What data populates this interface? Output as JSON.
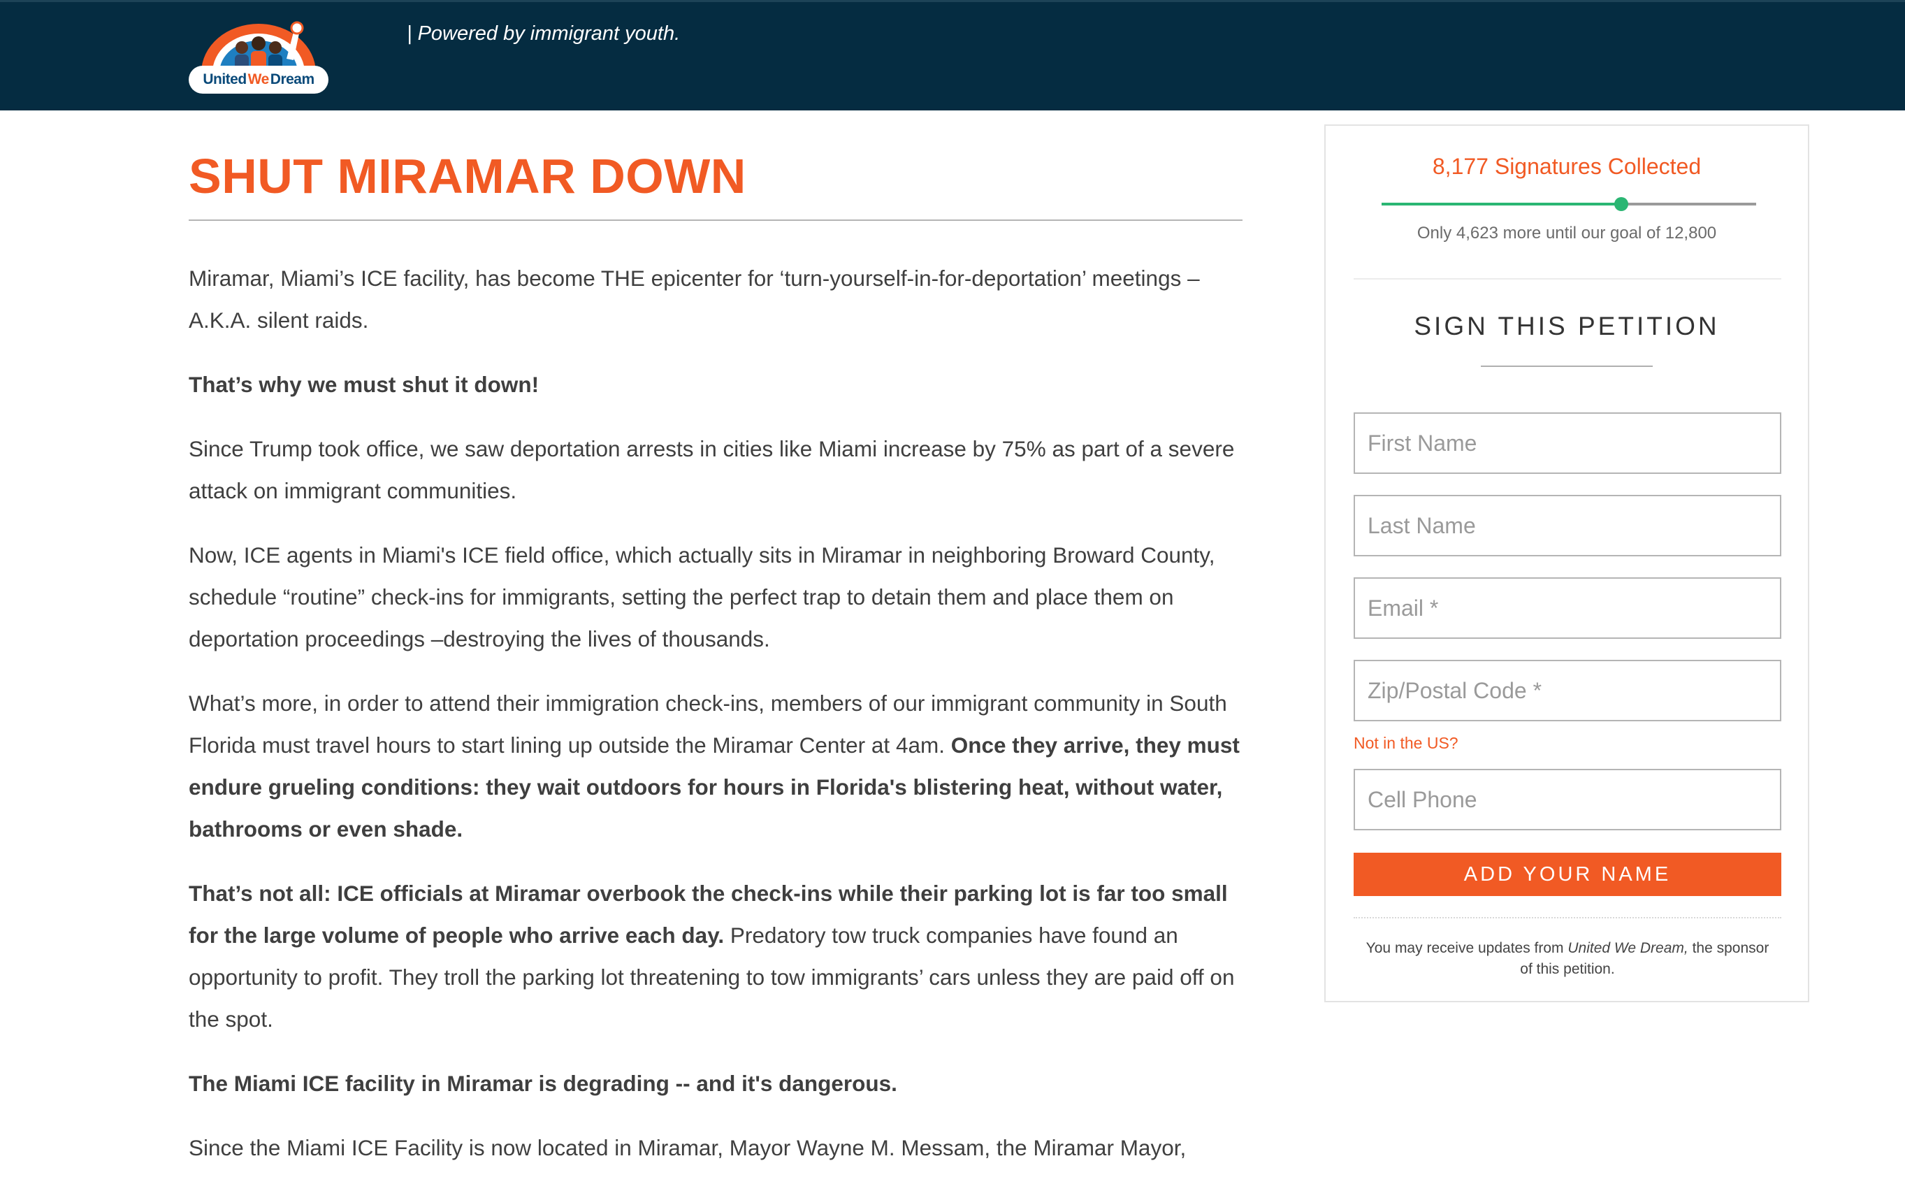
{
  "header": {
    "logo": {
      "word1": "United",
      "word2": "We",
      "word3": "Dream"
    },
    "tagline": "| Powered by immigrant youth.",
    "background": "#052c41"
  },
  "article": {
    "title": "SHUT MIRAMAR DOWN",
    "p1": "Miramar, Miami’s ICE facility, has become THE epicenter for ‘turn-yourself-in-for-deportation’ meetings – A.K.A. silent raids.",
    "p2": "That’s why we must shut it down!",
    "p3": "Since Trump took office, we saw deportation arrests in cities like Miami increase by 75% as part of a severe attack on immigrant communities.",
    "p4": "Now, ICE agents in Miami's ICE field office, which actually sits in Miramar in neighboring Broward County, schedule “routine” check-ins for immigrants, setting the perfect trap to detain them and place them on deportation proceedings –destroying the lives of thousands.",
    "p5_normal": "What’s more, in order to attend their immigration check-ins, members of our immigrant community in South Florida must travel hours to start lining up outside the Miramar Center at 4am.",
    "p5_bold": "Once they arrive, they must endure grueling conditions: they wait outdoors for hours in Florida's blistering heat, without water, bathrooms or even shade.",
    "p6_bold": "That’s not all: ICE officials at Miramar overbook the check-ins while their parking lot is far too small for the large volume of people who arrive each day.",
    "p6_normal": "Predatory tow truck companies have found an opportunity to profit. They troll the parking lot threatening to tow immigrants’ cars unless they are paid off on the spot.",
    "p7": "The Miami ICE facility in Miramar is degrading -- and it's dangerous.",
    "p8": "Since the Miami ICE Facility is now located in Miramar, Mayor Wayne M. Messam, the Miramar Mayor,"
  },
  "petition": {
    "signatures_label": "8,177 Signatures Collected",
    "signatures": 8177,
    "goal": 12800,
    "progress_fraction": 0.639,
    "goal_text": "Only 4,623 more until our goal of 12,800",
    "heading": "SIGN THIS PETITION",
    "fields": {
      "first_name": "First Name",
      "last_name": "Last Name",
      "email": "Email *",
      "zip": "Zip/Postal Code *",
      "phone": "Cell Phone"
    },
    "not_us_link": "Not in the US?",
    "submit_label": "ADD YOUR NAME",
    "disclaimer_pre": "You may receive updates from ",
    "disclaimer_org": "United We Dream,",
    "disclaimer_post": " the sponsor of this petition."
  },
  "colors": {
    "accent": "#f15a24",
    "progress": "#2bb673",
    "header_bg": "#052c41"
  }
}
